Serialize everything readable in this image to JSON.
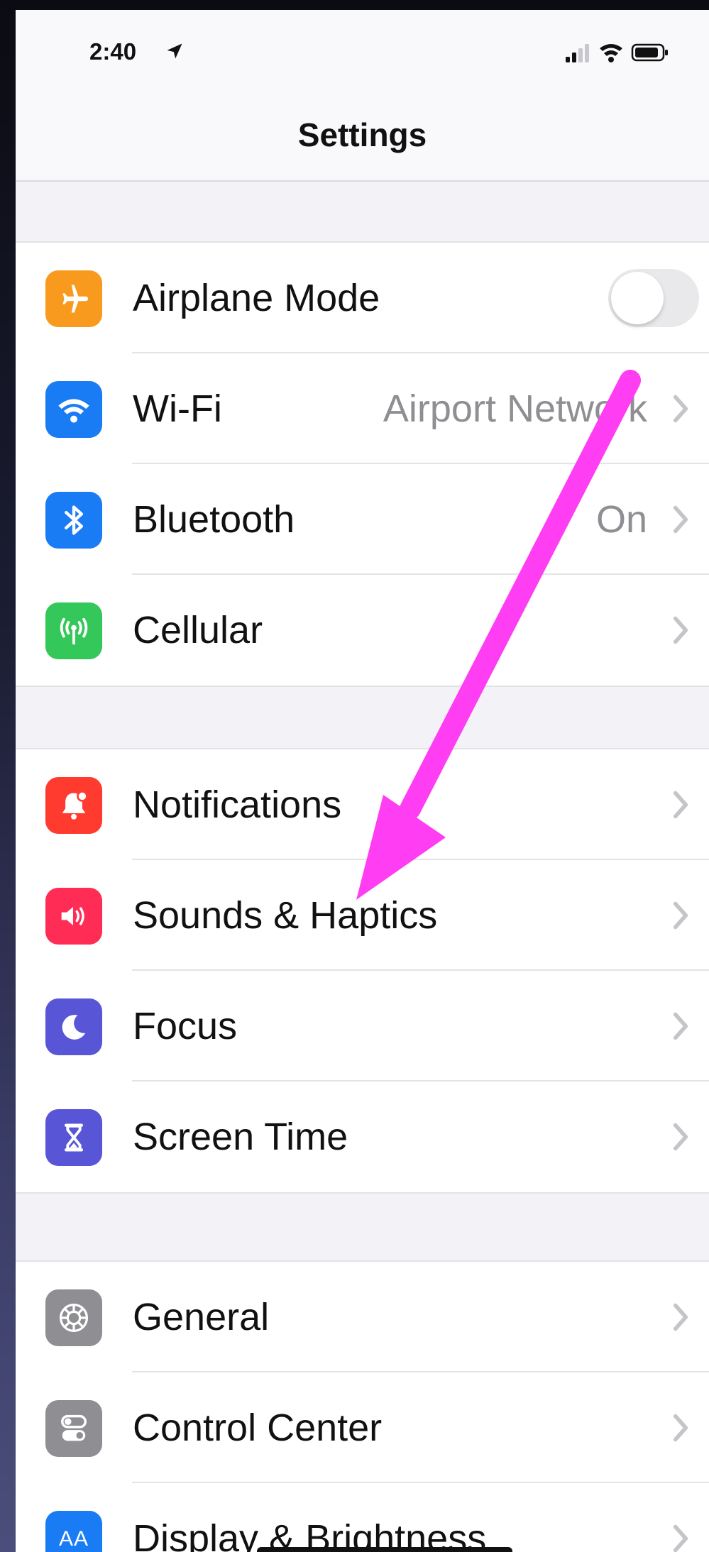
{
  "status_bar": {
    "time": "2:40"
  },
  "nav": {
    "title": "Settings"
  },
  "colors": {
    "airplane": "#f79a1e",
    "wifi": "#1a7cf5",
    "bluetooth": "#1a7cf5",
    "cellular": "#34c759",
    "notifications": "#ff3b30",
    "sounds": "#ff2d55",
    "focus": "#5856d6",
    "screen_time": "#5856d6",
    "general": "#8e8e93",
    "control_center": "#8e8e93",
    "display": "#1a7cf5",
    "arrow": "#ff3df2"
  },
  "groups": [
    {
      "items": [
        {
          "label": "Airplane Mode",
          "icon": "airplane-icon",
          "control": "toggle",
          "toggle_on": false
        },
        {
          "label": "Wi-Fi",
          "icon": "wifi-icon",
          "value": "Airport Network",
          "control": "chevron"
        },
        {
          "label": "Bluetooth",
          "icon": "bluetooth-icon",
          "value": "On",
          "control": "chevron"
        },
        {
          "label": "Cellular",
          "icon": "cellular-antenna-icon",
          "control": "chevron"
        }
      ]
    },
    {
      "items": [
        {
          "label": "Notifications",
          "icon": "notifications-bell-icon",
          "control": "chevron"
        },
        {
          "label": "Sounds & Haptics",
          "icon": "speaker-icon",
          "control": "chevron"
        },
        {
          "label": "Focus",
          "icon": "moon-icon",
          "control": "chevron"
        },
        {
          "label": "Screen Time",
          "icon": "hourglass-icon",
          "control": "chevron"
        }
      ]
    },
    {
      "items": [
        {
          "label": "General",
          "icon": "gear-icon",
          "control": "chevron"
        },
        {
          "label": "Control Center",
          "icon": "toggles-icon",
          "control": "chevron"
        },
        {
          "label": "Display & Brightness",
          "icon": "text-size-icon",
          "icon_text": "AA",
          "control": "chevron"
        }
      ]
    }
  ]
}
